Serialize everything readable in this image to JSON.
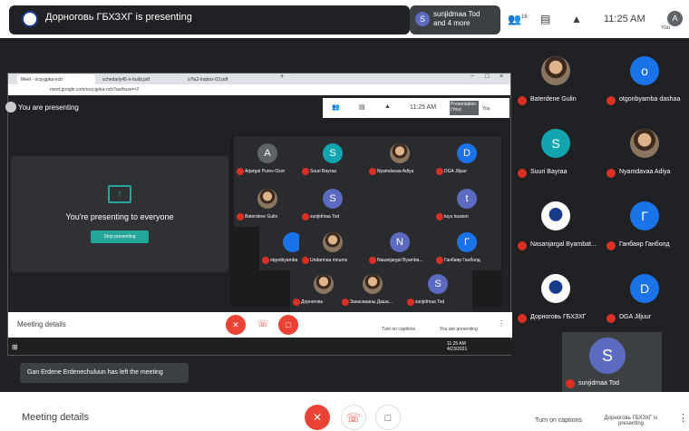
{
  "top": {
    "presenter_title": "Дорноговь ГБХЗХГ is presenting",
    "participants_chip": {
      "initial": "S",
      "line1": "sunjidmaa Tod",
      "line2": "and 4 more"
    },
    "people_count": "16",
    "time": "11:25 AM",
    "me": {
      "initial": "A",
      "label": "You"
    }
  },
  "browser": {
    "tabs": [
      "Meet - ocq-gpka-ncb",
      "schedarly45-n-build.pdf",
      "s7fa2-inqbox-03.pdf"
    ],
    "url": "meet.google.com/ocq-gpka-ncb?authuser=2",
    "inner_time": "11:25 AM",
    "inner_presentation": "Presentation (You)",
    "inner_you": "You",
    "you_are_presenting": "You are presenting",
    "presenting_to_everyone": "You're presenting to everyone",
    "stop_presenting": "Stop presenting",
    "tiles": [
      {
        "initial": "A",
        "color": "#5f6368",
        "name": "Arjargal Purev-Osor"
      },
      {
        "initial": "S",
        "color": "#12a4af",
        "name": "Suuri Bayraa"
      },
      {
        "initial": "",
        "color": "",
        "name": "Nyamdavaa Adiya"
      },
      {
        "initial": "D",
        "color": "#1a73e8",
        "name": "DGA Jiljuur"
      },
      {
        "initial": "",
        "color": "",
        "name": "Baterdene Gulin"
      },
      {
        "initial": "S",
        "color": "#5c6bc0",
        "name": "sunjidmaa Tod"
      },
      {
        "initial": "",
        "color": "",
        "name": ""
      },
      {
        "initial": "t",
        "color": "#5c6bc0",
        "name": "tuyu tsusien"
      },
      {
        "initial": "",
        "color": "#1a73e8",
        "name": "otgonbyamba"
      },
      {
        "initial": "",
        "color": "",
        "name": "Undarmaa mnums"
      },
      {
        "initial": "N",
        "color": "#5c6bc0",
        "name": "Nasanjargal Byamba..."
      },
      {
        "initial": "Г",
        "color": "#1a73e8",
        "name": "Ганбаяр Ганболд"
      },
      {
        "initial": "",
        "color": "",
        "name": "Дорноговь"
      },
      {
        "initial": "",
        "color": "",
        "name": "Занасвааны Даша..."
      },
      {
        "initial": "S",
        "color": "#5c6bc0",
        "name": "sunjidmaa Tod"
      }
    ],
    "meeting_details": "Meeting details",
    "turn_on_captions": "Turn on captions",
    "you_are_presenting_btn": "You are presenting",
    "taskbar_time": "11:25 AM",
    "taskbar_date": "4/23/2021"
  },
  "toast": "Gan Erdene Erdenechuluun has left the meeting",
  "sidebar": {
    "participants": [
      {
        "initial": "",
        "color": "",
        "name": "Baterdene Gulin"
      },
      {
        "initial": "o",
        "color": "#1a73e8",
        "name": "otgonbyamba dashaa"
      },
      {
        "initial": "S",
        "color": "#12a4af",
        "name": "Suuri Bayraa"
      },
      {
        "initial": "",
        "color": "",
        "name": "Nyamdavaa Adiya"
      },
      {
        "initial": "",
        "color": "",
        "name": "Nasanjargal Byambat..."
      },
      {
        "initial": "Г",
        "color": "#1a73e8",
        "name": "Ганбаяр Ганболд"
      },
      {
        "initial": "",
        "color": "",
        "name": "Дорноговь ГБХЗХГ"
      },
      {
        "initial": "D",
        "color": "#1a73e8",
        "name": "DGA Jiljuur"
      }
    ],
    "bottom": {
      "initial": "S",
      "color": "#5c6bc0",
      "name": "sunjidmaa Tod"
    }
  },
  "bottom": {
    "meeting_details": "Meeting details",
    "turn_on_captions": "Turn on captions",
    "presenting_label": "Дорноговь ГБХЗХГ is presenting"
  },
  "colors": {
    "accent": "#26a69a",
    "red": "#ea4335",
    "dark": "#202124"
  }
}
